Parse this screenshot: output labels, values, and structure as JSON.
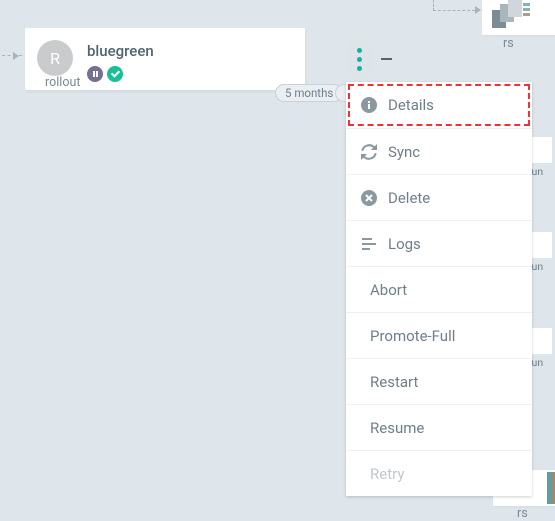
{
  "card": {
    "avatar_letter": "R",
    "title": "bluegreen",
    "kind": "rollout"
  },
  "timestamp_pill": "5 months",
  "rs_label": "rs",
  "run_label": "run",
  "menu": {
    "items": [
      {
        "label": "Details"
      },
      {
        "label": "Sync"
      },
      {
        "label": "Delete"
      },
      {
        "label": "Logs"
      },
      {
        "label": "Abort"
      },
      {
        "label": "Promote-Full"
      },
      {
        "label": "Restart"
      },
      {
        "label": "Resume"
      },
      {
        "label": "Retry"
      }
    ]
  }
}
